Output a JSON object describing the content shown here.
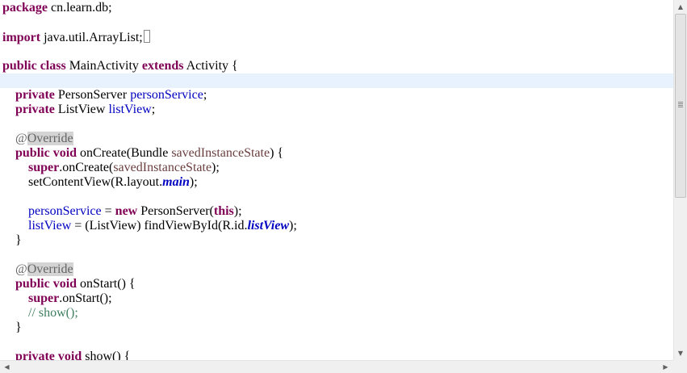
{
  "editor": {
    "l1": {
      "kw": "package",
      "rest": " cn.learn.db;"
    },
    "l3": {
      "kw": "import",
      "rest": " java.util.ArrayList;"
    },
    "l5": {
      "kw1": "public",
      "kw2": "class",
      "name": " MainActivity ",
      "kw3": "extends",
      "rest": " Activity {"
    },
    "l7": {
      "kw": "private",
      "type": " PersonServer ",
      "field": "personService",
      "end": ";"
    },
    "l8": {
      "kw": "private",
      "type": " ListView ",
      "field": "listView",
      "end": ";"
    },
    "l10": {
      "at": "@",
      "ann": "Override"
    },
    "l11": {
      "kw1": "public",
      "kw2": "void",
      "sig": " onCreate(Bundle ",
      "param": "savedInstanceState",
      "end": ") {"
    },
    "l12": {
      "kw": "super",
      "call": ".onCreate(",
      "param": "savedInstanceState",
      "end": ");"
    },
    "l13": {
      "pre": "setContentView(R.layout.",
      "sfield": "main",
      "end": ");"
    },
    "l15": {
      "field": "personService",
      "mid": " = ",
      "kw": "new",
      "call": " PersonServer(",
      "kw2": "this",
      "end": ");"
    },
    "l16": {
      "field": "listView",
      "mid": " = (ListView) findViewById(R.id.",
      "sfield": "listView",
      "end": ");"
    },
    "l17": {
      "text": "}"
    },
    "l19": {
      "at": "@",
      "ann": "Override"
    },
    "l20": {
      "kw1": "public",
      "kw2": "void",
      "sig": " onStart() {"
    },
    "l21": {
      "kw": "super",
      "call": ".onStart();"
    },
    "l22": {
      "comment": "// show();"
    },
    "l23": {
      "text": "}"
    },
    "l25": {
      "kw1": "private",
      "kw2": "void",
      "sig": " show() {"
    }
  },
  "scrollbar": {
    "up_arrow": "▲",
    "down_arrow": "▼",
    "left_arrow": "◀",
    "right_arrow": "▶",
    "up_icon": "arrow-up-icon",
    "down_icon": "arrow-down-icon",
    "left_icon": "arrow-left-icon",
    "right_icon": "arrow-right-icon"
  },
  "colors": {
    "keyword": "#7f0055",
    "field": "#0000c0",
    "parameter": "#6a3e3e",
    "comment": "#3f7f5f",
    "annotation": "#646464",
    "current_line": "#e8f2fe"
  }
}
